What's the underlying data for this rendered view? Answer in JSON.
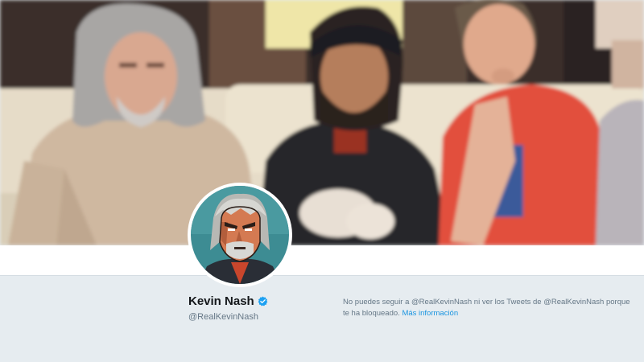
{
  "profile": {
    "display_name": "Kevin Nash",
    "screen_name": "@RealKevinNash",
    "verified": true
  },
  "header_image": {
    "description_icon": "header-photo"
  },
  "avatar_image": {
    "description_icon": "cartoon-avatar"
  },
  "blocked_notice": {
    "message": "No puedes seguir a @RealKevinNash ni ver los Tweets de @RealKevinNash porque te ha bloqueado.",
    "link_label": "Más información"
  },
  "colors": {
    "page_background": "#e6ecf0",
    "link": "#1b95e0",
    "verified_badge": "#1da1f2",
    "name_text": "#14171a",
    "secondary_text": "#657786"
  }
}
